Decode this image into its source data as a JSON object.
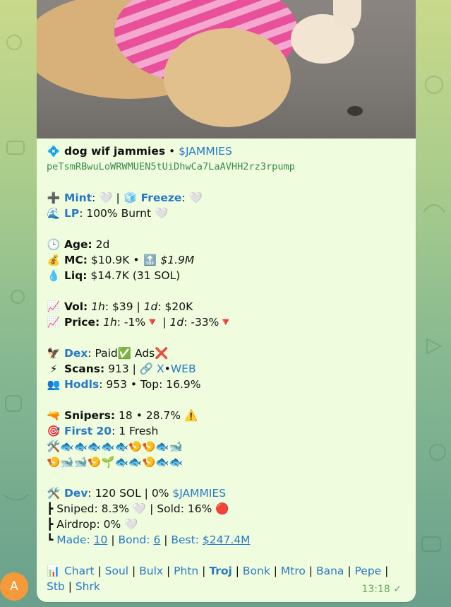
{
  "colors": {
    "bubble": "#effdde",
    "link": "#2a78c4",
    "address": "#3a8a4a",
    "time": "#6aa35c",
    "avatar": "#f59a3b"
  },
  "header": {
    "title": "dog wif jammies",
    "sep": " • ",
    "ticker": "$JAMMIES",
    "icon": "diamond-icon"
  },
  "address": "peTsmRBwuLoWRWMUEN5tUiDhwCa7LaAVHH2rz3rpump",
  "mint": {
    "label": "Mint",
    "status": "🤍"
  },
  "freeze": {
    "label": "Freeze",
    "status": "🤍"
  },
  "lp": {
    "label": "LP",
    "value": ": 100% Burnt 🤍"
  },
  "age": {
    "label": "Age:",
    "value": " 2d"
  },
  "mc": {
    "label": "MC:",
    "value": " $10.9K • ",
    "top": "$1.9M"
  },
  "liq": {
    "label": "Liq:",
    "value": " $14.7K (31 SOL)"
  },
  "vol": {
    "label": "Vol:",
    "h1": "1h",
    "v1": ": $39 | ",
    "d1": "1d",
    "v2": ": $20K"
  },
  "price": {
    "label": "Price:",
    "h1": "1h",
    "v1": ": -1%🔻 | ",
    "d1": "1d",
    "v2": ": -33%🔻"
  },
  "dex": {
    "label": "Dex",
    "value": ": Paid✅ Ads❌"
  },
  "scans": {
    "label": "Scans:",
    "value": " 913 | 🔗 ",
    "x": "X",
    "dot": "•",
    "web": "WEB"
  },
  "hodls": {
    "label": "Hodls",
    "value": ": 953 • Top: 16.9%"
  },
  "snipers": {
    "label": "Snipers:",
    "value": " 18 • 28.7% ⚠️"
  },
  "first20": {
    "label": "First 20",
    "value": ": 1 Fresh"
  },
  "emoji_row1": "🛠️🐟🐟🐟🐟🐟🍤🍤🐟🐋",
  "emoji_row2": "🍤🐋🐋🍤🌱🐟🐟🍤🐟🐟",
  "dev": {
    "label": "Dev",
    "value": ": 120 SOL | 0% ",
    "ticker": "$JAMMIES"
  },
  "sniped": {
    "prefix": "┣ Sniped: 8.3% 🤍 | Sold: 16% 🔴"
  },
  "airdrop": {
    "prefix": "┣ Airdrop: 0% 🤍"
  },
  "made": {
    "prefix": "┗ ",
    "made_label": "Made:",
    "made_val": "10",
    "bond_label": "Bond:",
    "bond_val": "6",
    "best_label": "Best:",
    "best_val": "$247.4M"
  },
  "links": [
    "Chart",
    "Soul",
    "Bulx",
    "Phtn",
    "Troj",
    "Bonk",
    "Mtro",
    "Bana",
    "Pepe",
    "Stb",
    "Shrk"
  ],
  "time": "13:18",
  "avatar": "A"
}
